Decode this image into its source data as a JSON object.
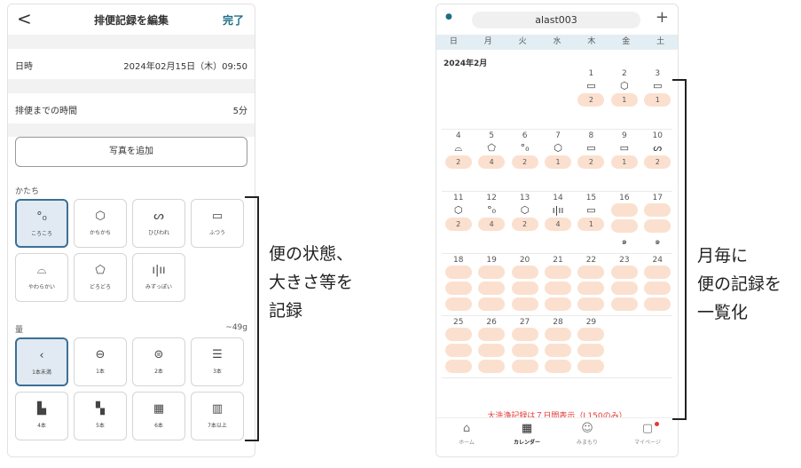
{
  "left": {
    "header": {
      "back": "<",
      "title": "排便記録を編集",
      "done": "完了"
    },
    "datetime": {
      "label": "日時",
      "value": "2024年02月15日（木）09:50"
    },
    "duration": {
      "label": "排便までの時間",
      "value": "5分"
    },
    "photo_button": "写真を追加",
    "shape_section": "かたち",
    "shapes": [
      {
        "label": "ころころ",
        "icon": "°₀",
        "selected": true
      },
      {
        "label": "かちかち",
        "icon": "⬡",
        "selected": false
      },
      {
        "label": "ひびわれ",
        "icon": "ᔕ",
        "selected": false
      },
      {
        "label": "ふつう",
        "icon": "▭",
        "selected": false
      },
      {
        "label": "やわらかい",
        "icon": "⌓",
        "selected": false
      },
      {
        "label": "どろどろ",
        "icon": "⬠",
        "selected": false
      },
      {
        "label": "みずっぽい",
        "icon": "ı|ıı",
        "selected": false
      }
    ],
    "amount_section": "量",
    "amount_max": "~49g",
    "amounts": [
      {
        "label": "1本未満",
        "icon": "‹",
        "selected": true
      },
      {
        "label": "1本",
        "icon": "⊖",
        "selected": false
      },
      {
        "label": "2本",
        "icon": "⊜",
        "selected": false
      },
      {
        "label": "3本",
        "icon": "☰",
        "selected": false
      },
      {
        "label": "4本",
        "icon": "▙",
        "selected": false
      },
      {
        "label": "5本",
        "icon": "▚",
        "selected": false
      },
      {
        "label": "6本",
        "icon": "▦",
        "selected": false
      },
      {
        "label": "7本以上",
        "icon": "▥",
        "selected": false
      }
    ]
  },
  "annotation_left": {
    "line1": "便の状態、",
    "line2": "大きさ等を",
    "line3": "記録"
  },
  "right": {
    "user_icon": "person-icon",
    "user": "alast003",
    "plus": "+",
    "weekdays": [
      "日",
      "月",
      "火",
      "水",
      "木",
      "金",
      "土"
    ],
    "month": "2024年2月",
    "weeks": [
      [
        {
          "d": ""
        },
        {
          "d": ""
        },
        {
          "d": ""
        },
        {
          "d": ""
        },
        {
          "d": "1",
          "icon": "▭",
          "count": "2"
        },
        {
          "d": "2",
          "icon": "⬡",
          "count": "1"
        },
        {
          "d": "3",
          "icon": "▭",
          "count": "1"
        }
      ],
      [
        {
          "d": "4",
          "icon": "⌓",
          "count": "2"
        },
        {
          "d": "5",
          "icon": "⬠",
          "count": "4"
        },
        {
          "d": "6",
          "icon": "°₀",
          "count": "2"
        },
        {
          "d": "7",
          "icon": "⬡",
          "count": "1"
        },
        {
          "d": "8",
          "icon": "▭",
          "count": "2"
        },
        {
          "d": "9",
          "icon": "▭",
          "count": "1"
        },
        {
          "d": "10",
          "icon": "ᔕ",
          "count": "2"
        }
      ],
      [
        {
          "d": "11",
          "icon": "⬡",
          "count": "2"
        },
        {
          "d": "12",
          "icon": "°₀",
          "count": "4"
        },
        {
          "d": "13",
          "icon": "⬡",
          "count": "2"
        },
        {
          "d": "14",
          "icon": "ı|ıı",
          "count": "4"
        },
        {
          "d": "15",
          "icon": "▭",
          "count": "1"
        },
        {
          "d": "16",
          "icon": "",
          "count": "",
          "swirl": "๑"
        },
        {
          "d": "17",
          "icon": "",
          "count": "",
          "swirl": "๑"
        }
      ],
      [
        {
          "d": "18"
        },
        {
          "d": "19"
        },
        {
          "d": "20"
        },
        {
          "d": "21"
        },
        {
          "d": "22"
        },
        {
          "d": "23"
        },
        {
          "d": "24"
        }
      ],
      [
        {
          "d": "25"
        },
        {
          "d": "26"
        },
        {
          "d": "27"
        },
        {
          "d": "28"
        },
        {
          "d": "29"
        },
        {
          "d": ""
        },
        {
          "d": ""
        }
      ]
    ],
    "notice": "大洗浄記録は７日間表示（L150のみ）",
    "tabs": [
      {
        "label": "ホーム",
        "icon": "⌂"
      },
      {
        "label": "カレンダー",
        "icon": "▦"
      },
      {
        "label": "みまもり",
        "icon": "☺"
      },
      {
        "label": "マイページ",
        "icon": "▢"
      }
    ]
  },
  "annotation_right": {
    "line1": "月毎に",
    "line2": "便の記録を",
    "line3": "一覧化"
  }
}
